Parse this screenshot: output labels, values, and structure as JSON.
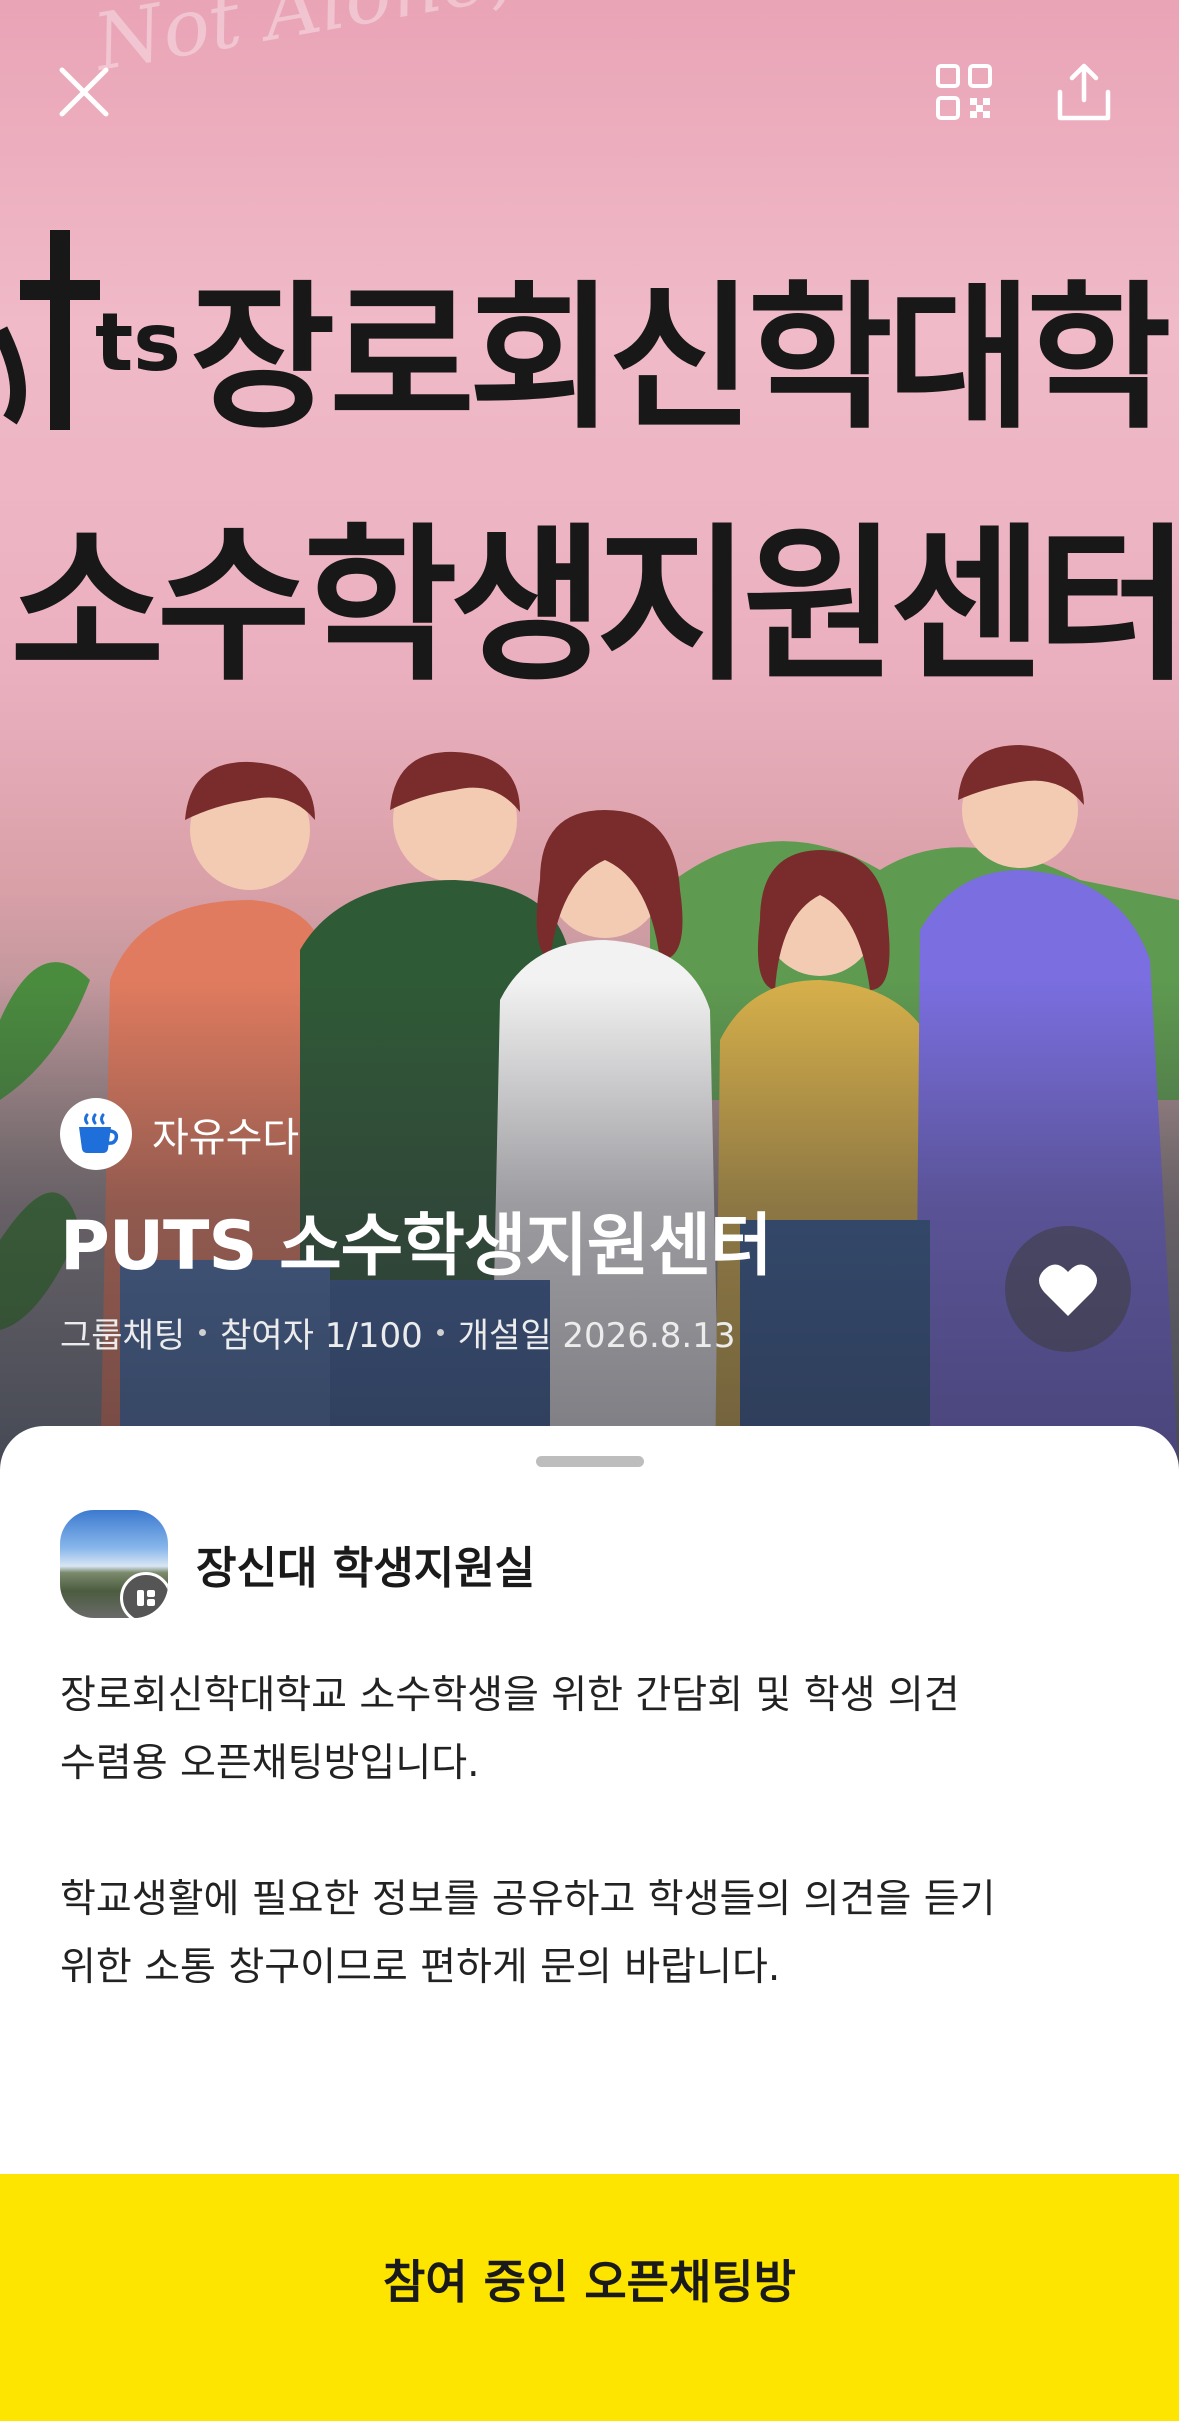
{
  "banner": {
    "line1": "장로회신학대학",
    "line2": "소수학생지원센터",
    "watermark": "Not Alone, But Together!"
  },
  "header": {
    "close_icon": "close-icon",
    "qr_icon": "qr-code-icon",
    "share_icon": "share-icon"
  },
  "room": {
    "category_icon": "coffee-cup-icon",
    "category": "자유수다",
    "title": "PUTS 소수학생지원센터",
    "type": "그룹채팅",
    "participants": "참여자 1/100",
    "opened": "개설일 2026.8.13",
    "like_icon": "heart-icon"
  },
  "owner": {
    "name": "장신대 학생지원실",
    "badge_icon": "profile-badge-icon"
  },
  "description": "장로회신학대학교 소수학생을 위한 간담회 및 학생 의견\n수렴용 오픈채팅방입니다.\n\n학교생활에 필요한 정보를 공유하고 학생들의 의견을 듣기\n위한 소통 창구이므로 편하게 문의 바랍니다.",
  "action": {
    "join_label": "참여 중인 오픈채팅방"
  },
  "colors": {
    "accent": "#FEE500",
    "category_icon": "#1E6FD9"
  }
}
